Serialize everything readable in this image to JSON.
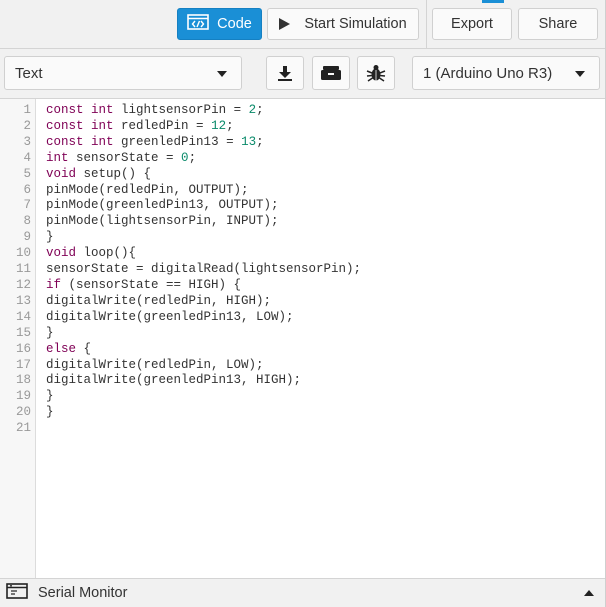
{
  "toolbar": {
    "code_label": "Code",
    "start_simulation_label": "Start Simulation",
    "export_label": "Export",
    "share_label": "Share"
  },
  "editor_toolbar": {
    "mode_value": "Text",
    "board_value": "1 (Arduino Uno R3)",
    "icons": [
      "download-icon",
      "library-icon",
      "debug-icon"
    ]
  },
  "code": {
    "line_numbers": [
      "1",
      "2",
      "3",
      "4",
      "5",
      "6",
      "7",
      "8",
      "9",
      "10",
      "11",
      "12",
      "13",
      "14",
      "15",
      "16",
      "17",
      "18",
      "19",
      "20",
      "21"
    ],
    "lines": [
      "const int lightsensorPin = 2;",
      "const int redledPin = 12;",
      "const int greenledPin13 = 13;",
      "int sensorState = 0;",
      "void setup() {",
      "pinMode(redledPin, OUTPUT);",
      "pinMode(greenledPin13, OUTPUT);",
      "pinMode(lightsensorPin, INPUT);",
      "}",
      "void loop(){",
      "sensorState = digitalRead(lightsensorPin);",
      "if (sensorState == HIGH) {",
      "digitalWrite(redledPin, HIGH);",
      "digitalWrite(greenledPin13, LOW);",
      "}",
      "else {",
      "digitalWrite(redledPin, LOW);",
      "digitalWrite(greenledPin13, HIGH);",
      "}",
      "}",
      ""
    ]
  },
  "serial_monitor": {
    "label": "Serial Monitor"
  },
  "colors": {
    "accent": "#1a8fd6",
    "keyword": "#7f0055",
    "number": "#0a8a6a"
  }
}
